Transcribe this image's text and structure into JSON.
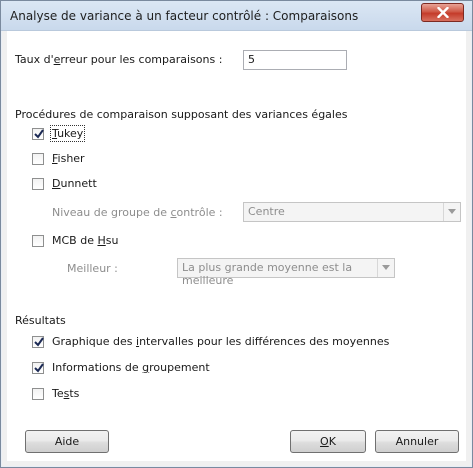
{
  "window": {
    "title": "Analyse de variance à un facteur contrôlé : Comparaisons",
    "close_icon": "close-icon"
  },
  "error_rate": {
    "label": "Taux d'erreur pour les comparaisons :",
    "value": "5"
  },
  "equal_variance_section": {
    "heading": "Procédures de comparaison supposant des variances égales",
    "tukey": {
      "label": "Tukey",
      "checked": true
    },
    "fisher": {
      "label": "Fisher",
      "checked": false
    },
    "dunnett": {
      "label": "Dunnett",
      "checked": false
    },
    "control_group": {
      "label": "Niveau de groupe de contrôle :",
      "value": "Centre"
    },
    "hsu": {
      "label": "MCB de Hsu",
      "checked": false
    },
    "best": {
      "label": "Meilleur :",
      "value": "La plus grande moyenne est la meilleure"
    }
  },
  "results_section": {
    "heading": "Résultats",
    "intervals_graph": {
      "label": "Graphique des intervalles pour les différences des moyennes",
      "checked": true
    },
    "grouping_info": {
      "label": "Informations de groupement",
      "checked": true
    },
    "tests": {
      "label": "Tests",
      "checked": false
    }
  },
  "buttons": {
    "help": "Aide",
    "ok": "OK",
    "cancel": "Annuler"
  }
}
